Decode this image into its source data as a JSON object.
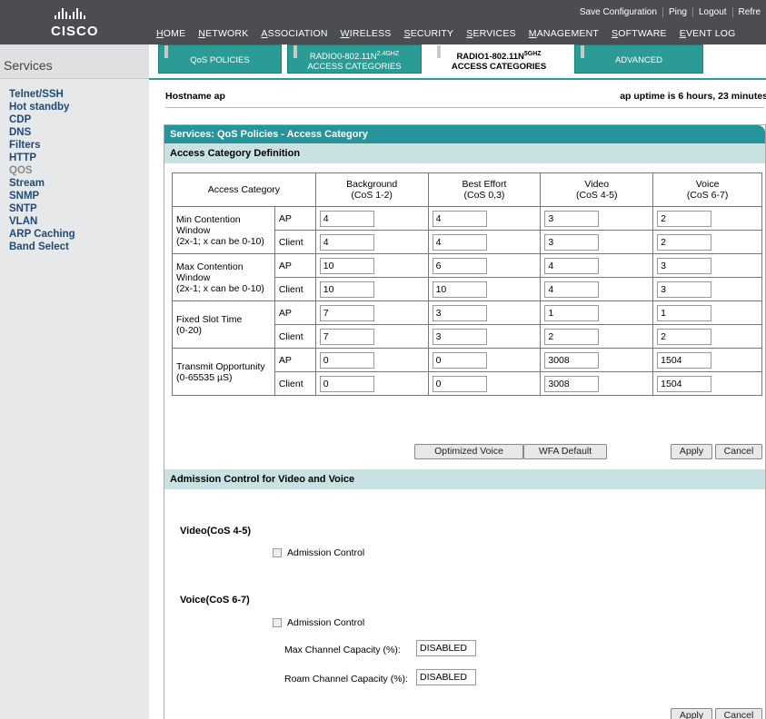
{
  "brand": {
    "word": "CISCO"
  },
  "toplinks": [
    "Save Configuration",
    "Ping",
    "Logout",
    "Refre"
  ],
  "topnav": [
    "HOME",
    "NETWORK",
    "ASSOCIATION",
    "WIRELESS",
    "SECURITY",
    "SERVICES",
    "MANAGEMENT",
    "SOFTWARE",
    "EVENT LOG"
  ],
  "sidebar": {
    "title": "Services",
    "items": [
      "Telnet/SSH",
      "Hot standby",
      "CDP",
      "DNS",
      "Filters",
      "HTTP",
      "QOS",
      "Stream",
      "SNMP",
      "SNTP",
      "VLAN",
      "ARP Caching",
      "Band Select"
    ],
    "active": "QOS"
  },
  "subtabs": {
    "qos": "QoS POLICIES",
    "radio0_line1": "RADIO0-802.11N",
    "radio0_sup": "2.4GHZ",
    "radio0_line2": "ACCESS CATEGORIES",
    "radio1_line1": "RADIO1-802.11N",
    "radio1_sup": "5GHZ",
    "radio1_line2": "ACCESS CATEGORIES",
    "advanced": "ADVANCED"
  },
  "host": {
    "left": "Hostname  ap",
    "right": "ap uptime is 6 hours, 23 minutes"
  },
  "panel_title": "Services: QoS Policies - Access Category",
  "acd_title": "Access Category Definition",
  "table": {
    "header_first": "Access Category",
    "columns": [
      {
        "name": "Background",
        "cos": "(CoS 1-2)"
      },
      {
        "name": "Best Effort",
        "cos": "(CoS 0,3)"
      },
      {
        "name": "Video",
        "cos": "(CoS 4-5)"
      },
      {
        "name": "Voice",
        "cos": "(CoS 6-7)"
      }
    ],
    "groups": [
      {
        "label1": "Min Contention",
        "label2": "Window",
        "label3": "(2x-1; x can be 0-10)",
        "rows": [
          {
            "who": "AP",
            "values": [
              "4",
              "4",
              "3",
              "2"
            ]
          },
          {
            "who": "Client",
            "values": [
              "4",
              "4",
              "3",
              "2"
            ]
          }
        ]
      },
      {
        "label1": "Max Contention",
        "label2": "Window",
        "label3": "(2x-1; x can be 0-10)",
        "rows": [
          {
            "who": "AP",
            "values": [
              "10",
              "6",
              "4",
              "3"
            ]
          },
          {
            "who": "Client",
            "values": [
              "10",
              "10",
              "4",
              "3"
            ]
          }
        ]
      },
      {
        "label1": "Fixed Slot Time",
        "label2": "(0-20)",
        "label3": "",
        "rows": [
          {
            "who": "AP",
            "values": [
              "7",
              "3",
              "1",
              "1"
            ]
          },
          {
            "who": "Client",
            "values": [
              "7",
              "3",
              "2",
              "2"
            ]
          }
        ]
      },
      {
        "label1": "Transmit Opportunity",
        "label2": "(0-65535 µS)",
        "label3": "",
        "rows": [
          {
            "who": "AP",
            "values": [
              "0",
              "0",
              "3008",
              "1504"
            ]
          },
          {
            "who": "Client",
            "values": [
              "0",
              "0",
              "3008",
              "1504"
            ]
          }
        ]
      }
    ]
  },
  "buttons": {
    "optimized_voice": "Optimized Voice",
    "wfa_default": "WFA Default",
    "apply": "Apply",
    "cancel": "Cancel"
  },
  "admission": {
    "title": "Admission Control for Video and Voice",
    "video_label": "Video(CoS 4-5)",
    "voice_label": "Voice(CoS 6-7)",
    "checkbox_label": "Admission Control",
    "max_channel_label": "Max Channel Capacity (%):",
    "max_channel_value": "DISABLED",
    "roam_channel_label": "Roam Channel Capacity (%):",
    "roam_channel_value": "DISABLED"
  }
}
